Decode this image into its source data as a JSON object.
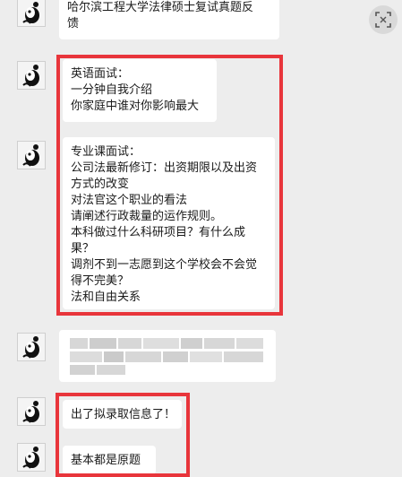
{
  "messages": {
    "m0": [
      "哈尔滨工程大学法律硕士复试真题反",
      "馈"
    ],
    "m1": [
      "英语面试：",
      "一分钟自我介绍",
      "你家庭中谁对你影响最大"
    ],
    "m2": [
      "专业课面试：",
      "公司法最新修订：出资期限以及出资",
      "方式的改变",
      "对法官这个职业的看法",
      "请阐述行政裁量的运作规则。",
      "本科做过什么科研项目？有什么成",
      "果？",
      "调剂不到一志愿到这个学校会不会觉",
      "得不完美？",
      "法和自由关系"
    ],
    "m4": [
      "出了拟录取信息了！"
    ],
    "m5": [
      "基本都是原题"
    ]
  },
  "icons": {
    "avatar": "panda-avatar-icon",
    "scan": "scan-icon"
  },
  "colors": {
    "highlight": "#e8353b",
    "bubble": "#ffffff",
    "background": "#ededed"
  }
}
